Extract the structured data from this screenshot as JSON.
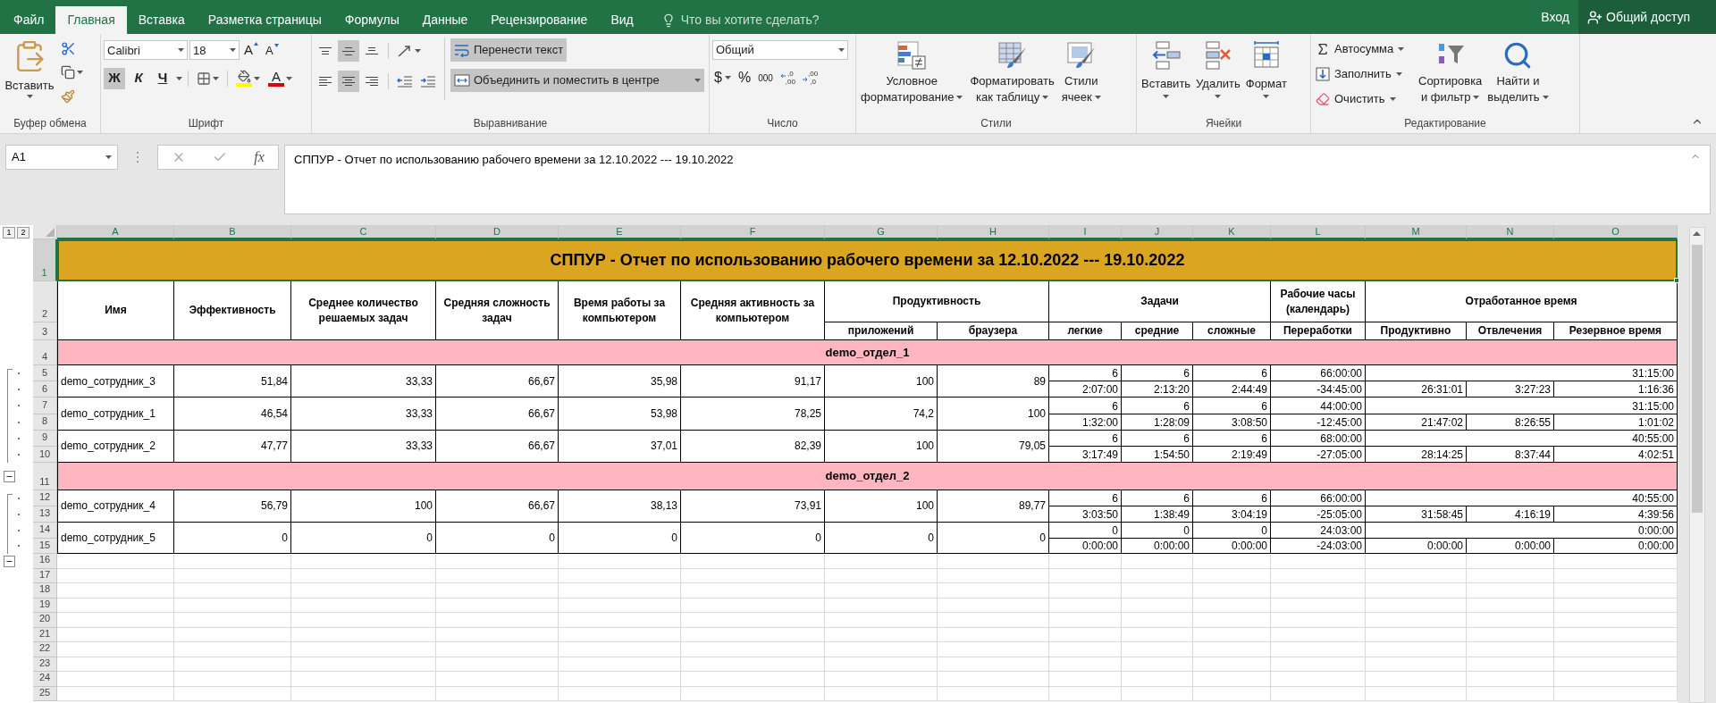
{
  "tabs": [
    {
      "label": "Файл",
      "selected": false
    },
    {
      "label": "Главная",
      "selected": true
    },
    {
      "label": "Вставка",
      "selected": false
    },
    {
      "label": "Разметка страницы",
      "selected": false
    },
    {
      "label": "Формулы",
      "selected": false
    },
    {
      "label": "Данные",
      "selected": false
    },
    {
      "label": "Рецензирование",
      "selected": false
    },
    {
      "label": "Вид",
      "selected": false
    }
  ],
  "tell_me": {
    "placeholder": "Что вы хотите сделать?"
  },
  "sign_in": "Вход",
  "share": "Общий доступ",
  "ribbon": {
    "clipboard": {
      "label": "Буфер обмена",
      "paste": "Вставить"
    },
    "font": {
      "label": "Шрифт",
      "name": "Calibri",
      "size": "18",
      "grow": "A",
      "shrink": "A",
      "font_color": "A",
      "styles": [
        {
          "kind": "bold",
          "text": "Ж",
          "selected": true
        },
        {
          "kind": "italic",
          "text": "К",
          "selected": false
        },
        {
          "kind": "underline",
          "text": "Ч",
          "selected": false
        }
      ]
    },
    "alignment": {
      "label": "Выравнивание",
      "vertical": [
        {
          "kind": "top",
          "selected": false
        },
        {
          "kind": "middle",
          "selected": true
        },
        {
          "kind": "bottom",
          "selected": false
        }
      ],
      "horizontal": [
        {
          "kind": "left",
          "selected": false
        },
        {
          "kind": "center",
          "selected": true
        },
        {
          "kind": "right",
          "selected": false
        }
      ],
      "wrap": {
        "text": "Перенести текст",
        "selected": true
      },
      "merge": {
        "text": "Объединить и поместить в центре",
        "selected": true
      }
    },
    "number": {
      "label": "Число",
      "format": "Общий",
      "symbols": [
        {
          "text": "$",
          "menu": true
        },
        {
          "text": "%",
          "menu": false
        },
        {
          "text": "000",
          "menu": false
        }
      ],
      "decimals": [
        {
          "kind": "increase",
          "lines": [
            ",0",
            ",00"
          ]
        },
        {
          "kind": "decrease",
          "lines": [
            ",00",
            ",0"
          ]
        }
      ]
    },
    "styles": {
      "label": "Стили",
      "buttons": [
        {
          "kind": "conditional",
          "lines": [
            "Условное",
            "форматирование"
          ]
        },
        {
          "kind": "table",
          "lines": [
            "Форматировать",
            "как таблицу"
          ]
        },
        {
          "kind": "cell_styles",
          "lines": [
            "Стили",
            "ячеек"
          ]
        }
      ]
    },
    "cells": {
      "label": "Ячейки",
      "buttons": [
        {
          "kind": "insert",
          "text": "Вставить"
        },
        {
          "kind": "delete",
          "text": "Удалить"
        },
        {
          "kind": "format",
          "text": "Формат"
        }
      ]
    },
    "editing": {
      "label": "Редактирование",
      "small": [
        {
          "kind": "autosum",
          "text": "Автосумма"
        },
        {
          "kind": "fill",
          "text": "Заполнить"
        },
        {
          "kind": "clear",
          "text": "Очистить"
        }
      ],
      "big": [
        {
          "kind": "sort",
          "lines": [
            "Сортировка",
            "и фильтр"
          ]
        },
        {
          "kind": "find",
          "lines": [
            "Найти и",
            "выделить"
          ]
        }
      ]
    }
  },
  "formula_bar": {
    "name_box": "A1",
    "fx": "fx",
    "value": "СППУР - Отчет по использованию рабочего времени за 12.10.2022 --- 19.10.2022"
  },
  "outline_levels": [
    "1",
    "2"
  ],
  "sheet": {
    "columns": [
      {
        "letter": "A",
        "selected": true
      },
      {
        "letter": "B",
        "selected": true
      },
      {
        "letter": "C",
        "selected": true
      },
      {
        "letter": "D",
        "selected": true
      },
      {
        "letter": "E",
        "selected": true
      },
      {
        "letter": "F",
        "selected": true
      },
      {
        "letter": "G",
        "selected": true
      },
      {
        "letter": "H",
        "selected": true
      },
      {
        "letter": "I",
        "selected": true
      },
      {
        "letter": "J",
        "selected": true
      },
      {
        "letter": "K",
        "selected": true
      },
      {
        "letter": "L",
        "selected": true
      },
      {
        "letter": "M",
        "selected": true
      },
      {
        "letter": "N",
        "selected": true
      },
      {
        "letter": "O",
        "selected": true
      }
    ],
    "rows": [
      {
        "number": "1",
        "selected": true
      },
      {
        "number": "2",
        "selected": false
      },
      {
        "number": "3",
        "selected": false
      },
      {
        "number": "4",
        "selected": false
      },
      {
        "number": "5",
        "selected": false
      },
      {
        "number": "6",
        "selected": false
      },
      {
        "number": "7",
        "selected": false
      },
      {
        "number": "8",
        "selected": false
      },
      {
        "number": "9",
        "selected": false
      },
      {
        "number": "10",
        "selected": false
      },
      {
        "number": "11",
        "selected": false
      },
      {
        "number": "12",
        "selected": false
      },
      {
        "number": "13",
        "selected": false
      },
      {
        "number": "14",
        "selected": false
      },
      {
        "number": "15",
        "selected": false
      },
      {
        "number": "16",
        "selected": false
      },
      {
        "number": "17",
        "selected": false
      },
      {
        "number": "18",
        "selected": false
      },
      {
        "number": "19",
        "selected": false
      },
      {
        "number": "20",
        "selected": false
      },
      {
        "number": "21",
        "selected": false
      },
      {
        "number": "22",
        "selected": false
      },
      {
        "number": "23",
        "selected": false
      },
      {
        "number": "24",
        "selected": false
      },
      {
        "number": "25",
        "selected": false
      }
    ],
    "title": "СППУР - Отчет по использованию рабочего времени за 12.10.2022 --- 19.10.2022",
    "headers": [
      {
        "text": "Имя"
      },
      {
        "text": "Эффективность"
      },
      {
        "text": "Среднее количество решаемых задач"
      },
      {
        "text": "Средняя сложность задач"
      },
      {
        "text": "Время работы за компьютером"
      },
      {
        "text": "Средняя активность за компьютером"
      },
      {
        "text": "Продуктивность",
        "sub": [
          "приложений",
          "браузера"
        ]
      },
      {
        "text": "Задачи",
        "sub": [
          "легкие",
          "средние",
          "сложные"
        ]
      },
      {
        "text": "Рабочие часы (календарь)",
        "sub": [
          "Переработки"
        ]
      },
      {
        "text": "Отработанное время",
        "sub": [
          "Продуктивно",
          "Отвлечения",
          "Резервное время"
        ]
      }
    ],
    "departments": [
      {
        "name": "demo_отдел_1",
        "employees": [
          {
            "name": "demo_сотрудник_3",
            "values": [
              "51,84",
              "33,33",
              "66,67",
              "35,98",
              "91,17",
              "100",
              "89"
            ],
            "task_counts": [
              "6",
              "6",
              "6"
            ],
            "task_times": [
              "2:07:00",
              "2:13:20",
              "2:44:49"
            ],
            "calendar_hours": "66:00:00",
            "overtime": "-34:45:00",
            "worked_total": "31:15:00",
            "productive": "26:31:01",
            "distraction": "3:27:23",
            "reserve": "1:16:36"
          },
          {
            "name": "demo_сотрудник_1",
            "values": [
              "46,54",
              "33,33",
              "66,67",
              "53,98",
              "78,25",
              "74,2",
              "100"
            ],
            "task_counts": [
              "6",
              "6",
              "6"
            ],
            "task_times": [
              "1:32:00",
              "1:28:09",
              "3:08:50"
            ],
            "calendar_hours": "44:00:00",
            "overtime": "-12:45:00",
            "worked_total": "31:15:00",
            "productive": "21:47:02",
            "distraction": "8:26:55",
            "reserve": "1:01:02"
          },
          {
            "name": "demo_сотрудник_2",
            "values": [
              "47,77",
              "33,33",
              "66,67",
              "37,01",
              "82,39",
              "100",
              "79,05"
            ],
            "task_counts": [
              "6",
              "6",
              "6"
            ],
            "task_times": [
              "3:17:49",
              "1:54:50",
              "2:19:49"
            ],
            "calendar_hours": "68:00:00",
            "overtime": "-27:05:00",
            "worked_total": "40:55:00",
            "productive": "28:14:25",
            "distraction": "8:37:44",
            "reserve": "4:02:51"
          }
        ]
      },
      {
        "name": "demo_отдел_2",
        "employees": [
          {
            "name": "demo_сотрудник_4",
            "values": [
              "56,79",
              "100",
              "66,67",
              "38,13",
              "73,91",
              "100",
              "89,77"
            ],
            "task_counts": [
              "6",
              "6",
              "6"
            ],
            "task_times": [
              "3:03:50",
              "1:38:49",
              "3:04:19"
            ],
            "calendar_hours": "66:00:00",
            "overtime": "-25:05:00",
            "worked_total": "40:55:00",
            "productive": "31:58:45",
            "distraction": "4:16:19",
            "reserve": "4:39:56"
          },
          {
            "name": "demo_сотрудник_5",
            "values": [
              "0",
              "0",
              "0",
              "0",
              "0",
              "0",
              "0"
            ],
            "task_counts": [
              "0",
              "0",
              "0"
            ],
            "task_times": [
              "0:00:00",
              "0:00:00",
              "0:00:00"
            ],
            "calendar_hours": "24:03:00",
            "overtime": "-24:03:00",
            "worked_total": "0:00:00",
            "productive": "0:00:00",
            "distraction": "0:00:00",
            "reserve": "0:00:00"
          }
        ]
      }
    ]
  }
}
